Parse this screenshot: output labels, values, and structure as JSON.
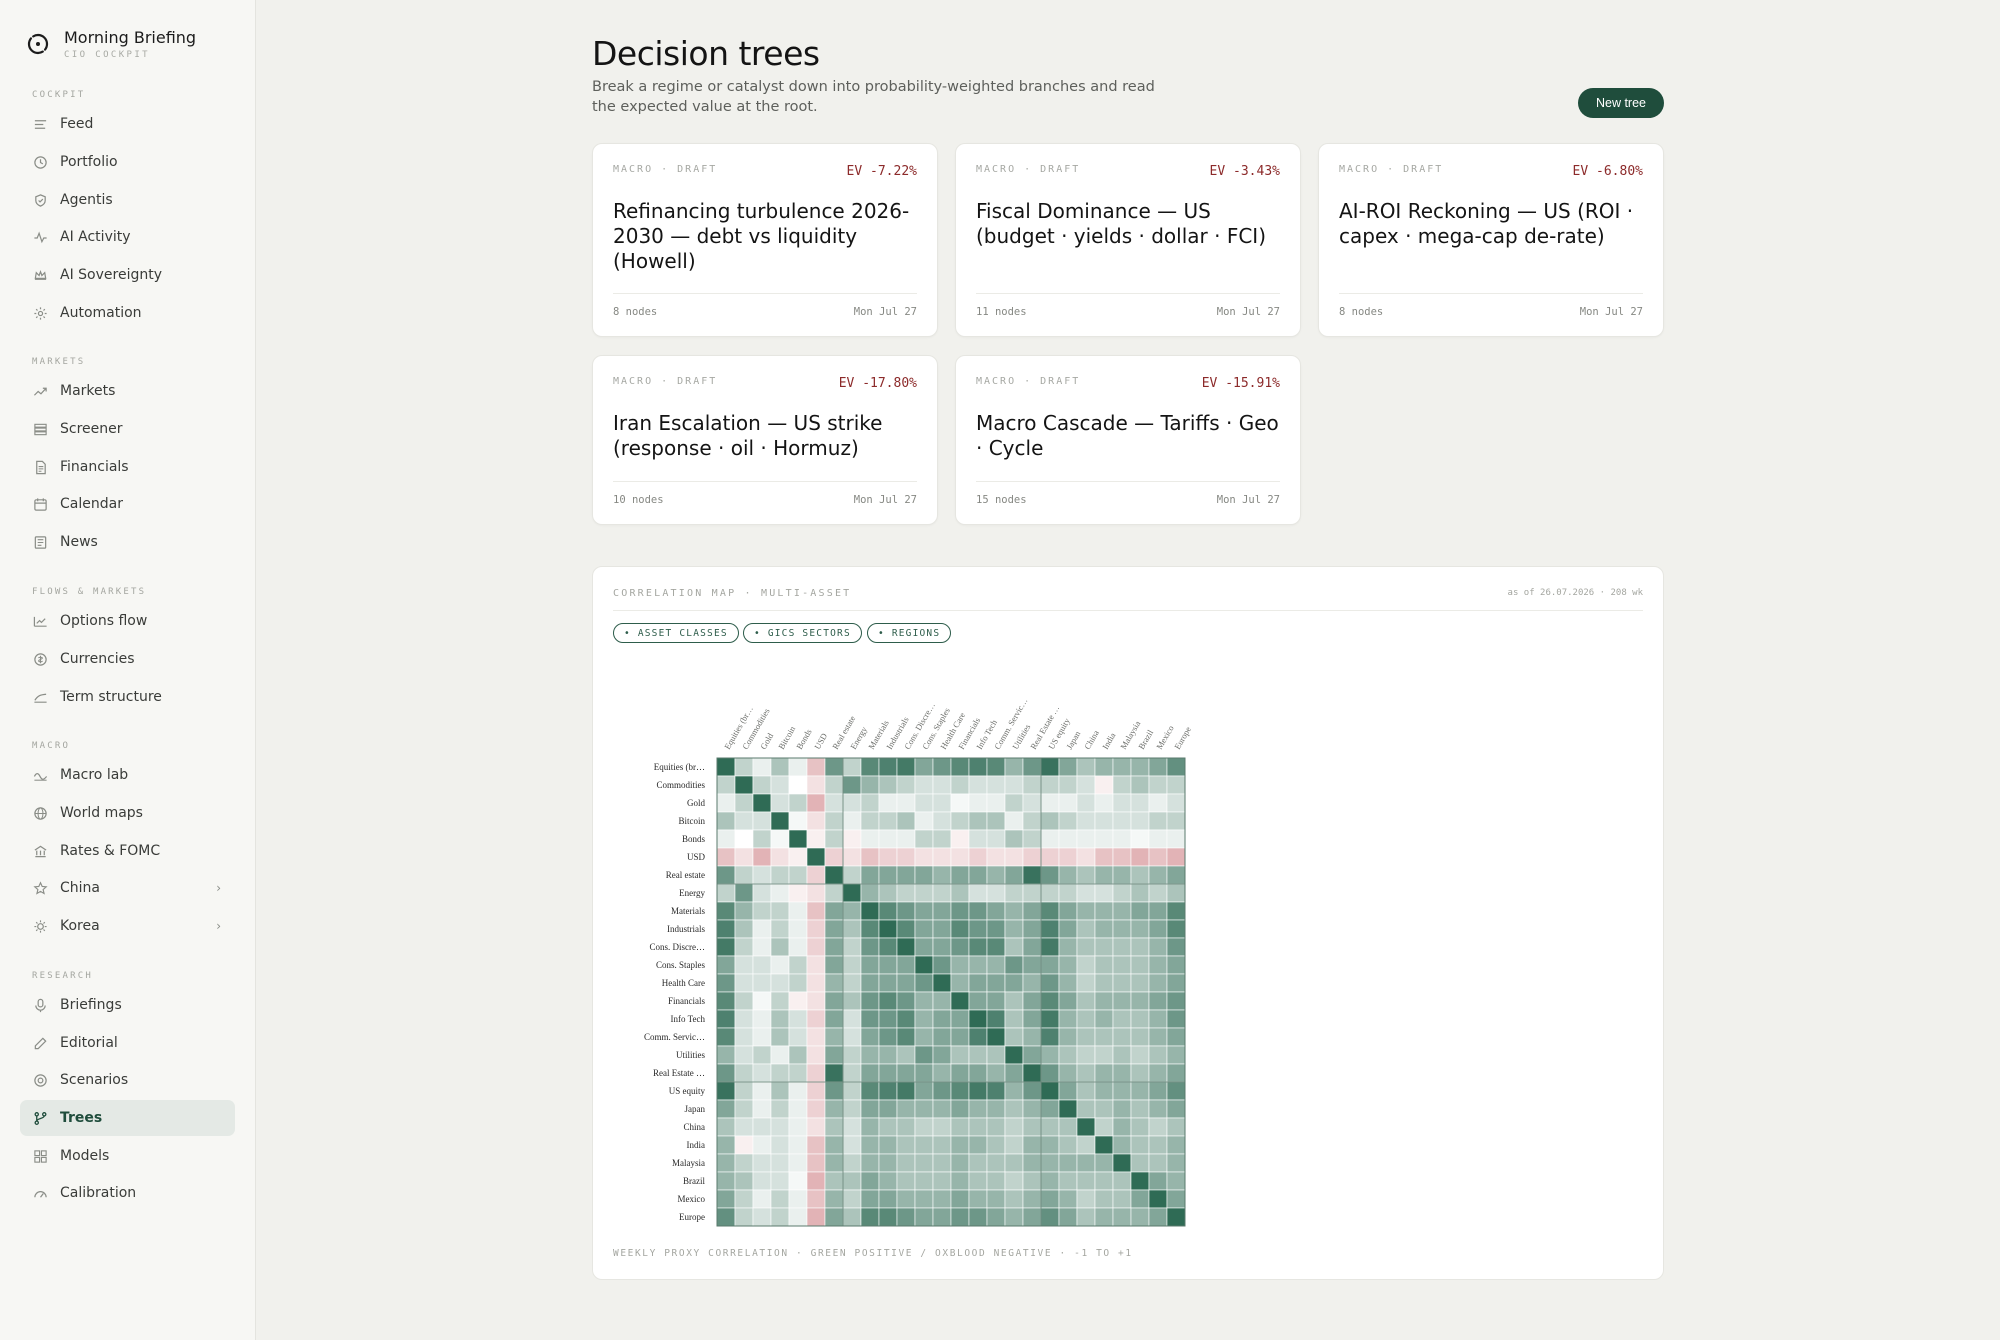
{
  "brand": {
    "title": "Morning Briefing",
    "subtitle": "CIO COCKPIT"
  },
  "sidebar": {
    "sections": [
      {
        "label": "COCKPIT",
        "items": [
          {
            "label": "Feed",
            "icon": "feed-icon"
          },
          {
            "label": "Portfolio",
            "icon": "clock-icon"
          },
          {
            "label": "Agentis",
            "icon": "shield-icon"
          },
          {
            "label": "AI Activity",
            "icon": "pulse-icon"
          },
          {
            "label": "AI Sovereignty",
            "icon": "crown-icon"
          },
          {
            "label": "Automation",
            "icon": "gear-icon"
          }
        ]
      },
      {
        "label": "MARKETS",
        "items": [
          {
            "label": "Markets",
            "icon": "trend-icon"
          },
          {
            "label": "Screener",
            "icon": "layers-icon"
          },
          {
            "label": "Financials",
            "icon": "document-icon"
          },
          {
            "label": "Calendar",
            "icon": "calendar-icon"
          },
          {
            "label": "News",
            "icon": "news-icon"
          }
        ]
      },
      {
        "label": "FLOWS & MARKETS",
        "items": [
          {
            "label": "Options flow",
            "icon": "flow-icon"
          },
          {
            "label": "Currencies",
            "icon": "currency-icon"
          },
          {
            "label": "Term structure",
            "icon": "curve-icon"
          }
        ]
      },
      {
        "label": "MACRO",
        "items": [
          {
            "label": "Macro lab",
            "icon": "wave-icon"
          },
          {
            "label": "World maps",
            "icon": "globe-icon"
          },
          {
            "label": "Rates & FOMC",
            "icon": "bank-icon"
          },
          {
            "label": "China",
            "icon": "star-icon",
            "expandable": true
          },
          {
            "label": "Korea",
            "icon": "sun-icon",
            "expandable": true
          }
        ]
      },
      {
        "label": "RESEARCH",
        "items": [
          {
            "label": "Briefings",
            "icon": "mic-icon"
          },
          {
            "label": "Editorial",
            "icon": "pen-icon"
          },
          {
            "label": "Scenarios",
            "icon": "target-icon"
          },
          {
            "label": "Trees",
            "icon": "branch-icon",
            "active": true
          },
          {
            "label": "Models",
            "icon": "grid-icon"
          },
          {
            "label": "Calibration",
            "icon": "gauge-icon"
          }
        ]
      }
    ]
  },
  "header": {
    "title": "Decision trees",
    "description": "Break a regime or catalyst down into probability-weighted branches and read the expected value at the root.",
    "new_button": "New tree"
  },
  "cards": [
    {
      "tag": "MACRO · DRAFT",
      "ev": "EV -7.22%",
      "title": "Refinancing turbulence 2026-2030 — debt vs liquidity (Howell)",
      "nodes": "8 nodes",
      "date": "Mon Jul 27"
    },
    {
      "tag": "MACRO · DRAFT",
      "ev": "EV -3.43%",
      "title": "Fiscal Dominance — US (budget · yields · dollar · FCI)",
      "nodes": "11 nodes",
      "date": "Mon Jul 27"
    },
    {
      "tag": "MACRO · DRAFT",
      "ev": "EV -6.80%",
      "title": "AI-ROI Reckoning — US (ROI · capex · mega-cap de-rate)",
      "nodes": "8 nodes",
      "date": "Mon Jul 27"
    },
    {
      "tag": "MACRO · DRAFT",
      "ev": "EV -17.80%",
      "title": "Iran Escalation — US strike (response · oil · Hormuz)",
      "nodes": "10 nodes",
      "date": "Mon Jul 27"
    },
    {
      "tag": "MACRO · DRAFT",
      "ev": "EV -15.91%",
      "title": "Macro Cascade — Tariffs · Geo · Cycle",
      "nodes": "15 nodes",
      "date": "Mon Jul 27"
    }
  ],
  "correlation": {
    "title": "CORRELATION MAP · MULTI-ASSET",
    "as_of": "as of 26.07.2026 · 208 wk",
    "chips": [
      "• ASSET CLASSES",
      "• GICS SECTORS",
      "• REGIONS"
    ],
    "footer": "WEEKLY PROXY CORRELATION · GREEN POSITIVE / OXBLOOD NEGATIVE · -1 TO +1",
    "colors": {
      "positive": "#2f6b55",
      "negative": "#c4676c",
      "neutral": "#ffffff"
    }
  },
  "chart_data": {
    "type": "heatmap",
    "row_labels": [
      "Equities (br…",
      "Commodities",
      "Gold",
      "Bitcoin",
      "Bonds",
      "USD",
      "Real estate",
      "Energy",
      "Materials",
      "Industrials",
      "Cons. Discre…",
      "Cons. Staples",
      "Health Care",
      "Financials",
      "Info Tech",
      "Comm. Servic…",
      "Utilities",
      "Real Estate …",
      "US equity",
      "Japan",
      "China",
      "India",
      "Malaysia",
      "Brazil",
      "Mexico",
      "Europe"
    ],
    "col_labels": [
      "Equities (br…",
      "Commodities",
      "Gold",
      "Bitcoin",
      "Bonds",
      "USD",
      "Real estate",
      "Energy",
      "Materials",
      "Industrials",
      "Cons. Discre…",
      "Cons. Staples",
      "Health Care",
      "Financials",
      "Info Tech",
      "Comm. Servic…",
      "Utilities",
      "Real Estate …",
      "US equity",
      "Japan",
      "China",
      "India",
      "Malaysia",
      "Brazil",
      "Mexico",
      "Europe"
    ],
    "values": [
      [
        1.0,
        0.3,
        0.1,
        0.4,
        0.1,
        -0.4,
        0.7,
        0.3,
        0.8,
        0.85,
        0.9,
        0.6,
        0.7,
        0.8,
        0.85,
        0.8,
        0.5,
        0.7,
        0.95,
        0.6,
        0.4,
        0.5,
        0.5,
        0.5,
        0.6,
        0.75
      ],
      [
        0.3,
        1.0,
        0.3,
        0.2,
        0.0,
        -0.2,
        0.3,
        0.7,
        0.5,
        0.4,
        0.3,
        0.2,
        0.2,
        0.3,
        0.2,
        0.2,
        0.2,
        0.3,
        0.3,
        0.3,
        0.2,
        -0.1,
        0.3,
        0.4,
        0.3,
        0.3
      ],
      [
        0.1,
        0.3,
        1.0,
        0.2,
        0.3,
        -0.5,
        0.2,
        0.2,
        0.3,
        0.1,
        0.1,
        0.2,
        0.2,
        0.05,
        0.1,
        0.1,
        0.3,
        0.2,
        0.1,
        0.1,
        0.2,
        0.1,
        0.2,
        0.2,
        0.1,
        0.2
      ],
      [
        0.4,
        0.2,
        0.2,
        1.0,
        0.05,
        -0.2,
        0.3,
        0.1,
        0.3,
        0.3,
        0.4,
        0.1,
        0.2,
        0.3,
        0.4,
        0.4,
        0.1,
        0.3,
        0.4,
        0.3,
        0.2,
        0.2,
        0.2,
        0.2,
        0.3,
        0.3
      ],
      [
        0.1,
        0.0,
        0.3,
        0.05,
        1.0,
        -0.1,
        0.3,
        -0.1,
        0.1,
        0.1,
        0.1,
        0.3,
        0.3,
        -0.1,
        0.2,
        0.2,
        0.4,
        0.3,
        0.1,
        0.1,
        0.1,
        0.1,
        0.1,
        0.05,
        0.1,
        0.1
      ],
      [
        -0.4,
        -0.2,
        -0.5,
        -0.2,
        -0.1,
        1.0,
        -0.3,
        -0.2,
        -0.4,
        -0.3,
        -0.3,
        -0.2,
        -0.2,
        -0.2,
        -0.3,
        -0.2,
        -0.2,
        -0.3,
        -0.3,
        -0.3,
        -0.2,
        -0.4,
        -0.4,
        -0.5,
        -0.4,
        -0.5
      ],
      [
        0.7,
        0.3,
        0.2,
        0.3,
        0.3,
        -0.3,
        1.0,
        0.3,
        0.6,
        0.6,
        0.6,
        0.6,
        0.5,
        0.6,
        0.6,
        0.5,
        0.6,
        0.95,
        0.7,
        0.5,
        0.4,
        0.5,
        0.5,
        0.4,
        0.5,
        0.6
      ],
      [
        0.3,
        0.7,
        0.2,
        0.1,
        -0.1,
        -0.2,
        0.3,
        1.0,
        0.5,
        0.4,
        0.3,
        0.3,
        0.3,
        0.4,
        0.2,
        0.2,
        0.3,
        0.3,
        0.3,
        0.3,
        0.2,
        0.2,
        0.3,
        0.4,
        0.3,
        0.4
      ],
      [
        0.8,
        0.5,
        0.3,
        0.3,
        0.1,
        -0.4,
        0.6,
        0.5,
        1.0,
        0.8,
        0.7,
        0.6,
        0.6,
        0.7,
        0.7,
        0.6,
        0.5,
        0.6,
        0.8,
        0.6,
        0.5,
        0.5,
        0.5,
        0.6,
        0.6,
        0.8
      ],
      [
        0.85,
        0.4,
        0.1,
        0.3,
        0.1,
        -0.3,
        0.6,
        0.4,
        0.8,
        1.0,
        0.8,
        0.6,
        0.6,
        0.8,
        0.7,
        0.7,
        0.5,
        0.6,
        0.85,
        0.6,
        0.4,
        0.5,
        0.5,
        0.5,
        0.6,
        0.8
      ],
      [
        0.9,
        0.3,
        0.1,
        0.4,
        0.1,
        -0.3,
        0.6,
        0.3,
        0.7,
        0.8,
        1.0,
        0.6,
        0.6,
        0.7,
        0.8,
        0.8,
        0.4,
        0.6,
        0.9,
        0.5,
        0.4,
        0.4,
        0.4,
        0.4,
        0.5,
        0.7
      ],
      [
        0.6,
        0.2,
        0.2,
        0.1,
        0.3,
        -0.2,
        0.6,
        0.3,
        0.6,
        0.6,
        0.6,
        1.0,
        0.7,
        0.5,
        0.5,
        0.5,
        0.7,
        0.6,
        0.6,
        0.5,
        0.3,
        0.4,
        0.4,
        0.4,
        0.5,
        0.6
      ],
      [
        0.7,
        0.2,
        0.2,
        0.2,
        0.3,
        -0.2,
        0.5,
        0.3,
        0.6,
        0.6,
        0.6,
        0.7,
        1.0,
        0.5,
        0.6,
        0.6,
        0.6,
        0.5,
        0.7,
        0.5,
        0.3,
        0.4,
        0.4,
        0.4,
        0.5,
        0.6
      ],
      [
        0.8,
        0.3,
        0.05,
        0.3,
        -0.1,
        -0.2,
        0.6,
        0.4,
        0.7,
        0.8,
        0.7,
        0.5,
        0.5,
        1.0,
        0.6,
        0.6,
        0.4,
        0.6,
        0.8,
        0.6,
        0.4,
        0.5,
        0.5,
        0.5,
        0.6,
        0.7
      ],
      [
        0.85,
        0.2,
        0.1,
        0.4,
        0.2,
        -0.3,
        0.6,
        0.2,
        0.7,
        0.7,
        0.8,
        0.5,
        0.6,
        0.6,
        1.0,
        0.85,
        0.4,
        0.6,
        0.9,
        0.5,
        0.4,
        0.5,
        0.4,
        0.4,
        0.5,
        0.7
      ],
      [
        0.8,
        0.2,
        0.1,
        0.4,
        0.2,
        -0.2,
        0.5,
        0.2,
        0.6,
        0.7,
        0.8,
        0.5,
        0.6,
        0.6,
        0.85,
        1.0,
        0.4,
        0.5,
        0.85,
        0.5,
        0.4,
        0.4,
        0.4,
        0.4,
        0.5,
        0.6
      ],
      [
        0.5,
        0.2,
        0.3,
        0.1,
        0.4,
        -0.2,
        0.6,
        0.3,
        0.5,
        0.5,
        0.4,
        0.7,
        0.6,
        0.4,
        0.4,
        0.4,
        1.0,
        0.6,
        0.5,
        0.4,
        0.3,
        0.3,
        0.4,
        0.3,
        0.4,
        0.5
      ],
      [
        0.7,
        0.3,
        0.2,
        0.3,
        0.3,
        -0.3,
        0.95,
        0.3,
        0.6,
        0.6,
        0.6,
        0.6,
        0.5,
        0.6,
        0.6,
        0.5,
        0.6,
        1.0,
        0.7,
        0.5,
        0.4,
        0.5,
        0.5,
        0.4,
        0.5,
        0.6
      ],
      [
        0.95,
        0.3,
        0.1,
        0.4,
        0.1,
        -0.3,
        0.7,
        0.3,
        0.8,
        0.85,
        0.9,
        0.6,
        0.7,
        0.8,
        0.9,
        0.85,
        0.5,
        0.7,
        1.0,
        0.6,
        0.4,
        0.5,
        0.5,
        0.5,
        0.6,
        0.75
      ],
      [
        0.6,
        0.3,
        0.1,
        0.3,
        0.1,
        -0.3,
        0.5,
        0.3,
        0.6,
        0.6,
        0.5,
        0.5,
        0.5,
        0.6,
        0.5,
        0.5,
        0.4,
        0.5,
        0.6,
        1.0,
        0.4,
        0.4,
        0.5,
        0.4,
        0.5,
        0.6
      ],
      [
        0.4,
        0.2,
        0.2,
        0.2,
        0.1,
        -0.2,
        0.4,
        0.2,
        0.5,
        0.4,
        0.4,
        0.3,
        0.3,
        0.4,
        0.4,
        0.4,
        0.3,
        0.4,
        0.4,
        0.4,
        1.0,
        0.3,
        0.5,
        0.4,
        0.3,
        0.4
      ],
      [
        0.5,
        -0.1,
        0.1,
        0.2,
        0.1,
        -0.4,
        0.5,
        0.2,
        0.5,
        0.5,
        0.4,
        0.4,
        0.4,
        0.5,
        0.5,
        0.4,
        0.3,
        0.5,
        0.5,
        0.4,
        0.3,
        1.0,
        0.5,
        0.4,
        0.4,
        0.5
      ],
      [
        0.5,
        0.3,
        0.2,
        0.2,
        0.1,
        -0.4,
        0.5,
        0.3,
        0.5,
        0.5,
        0.4,
        0.4,
        0.4,
        0.5,
        0.4,
        0.4,
        0.4,
        0.5,
        0.5,
        0.5,
        0.5,
        0.5,
        1.0,
        0.4,
        0.4,
        0.5
      ],
      [
        0.5,
        0.4,
        0.2,
        0.2,
        0.05,
        -0.5,
        0.4,
        0.4,
        0.6,
        0.5,
        0.4,
        0.4,
        0.4,
        0.5,
        0.4,
        0.4,
        0.3,
        0.4,
        0.5,
        0.4,
        0.4,
        0.4,
        0.4,
        1.0,
        0.6,
        0.5
      ],
      [
        0.6,
        0.3,
        0.1,
        0.3,
        0.1,
        -0.4,
        0.5,
        0.3,
        0.6,
        0.6,
        0.5,
        0.5,
        0.5,
        0.6,
        0.5,
        0.5,
        0.4,
        0.5,
        0.6,
        0.5,
        0.3,
        0.4,
        0.4,
        0.6,
        1.0,
        0.6
      ],
      [
        0.75,
        0.3,
        0.2,
        0.3,
        0.1,
        -0.5,
        0.6,
        0.4,
        0.8,
        0.8,
        0.7,
        0.6,
        0.6,
        0.7,
        0.7,
        0.6,
        0.5,
        0.6,
        0.75,
        0.6,
        0.4,
        0.5,
        0.5,
        0.5,
        0.6,
        1.0
      ]
    ],
    "range": [
      -1,
      1
    ],
    "grid": true
  }
}
